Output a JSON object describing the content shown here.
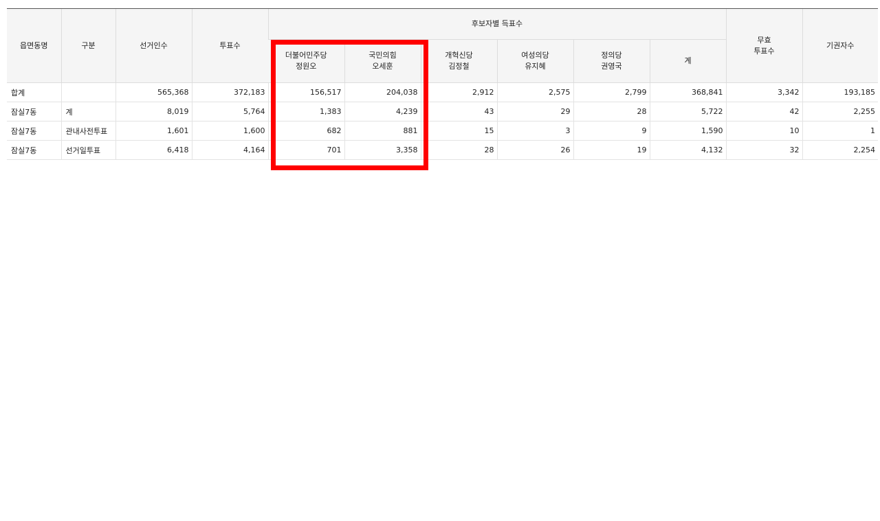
{
  "header": {
    "col_district": "읍면동명",
    "col_category": "구분",
    "col_electors": "선거인수",
    "col_voters": "투표수",
    "group_candidates": "후보자별 득표수",
    "col_invalid": "무효\n투표수",
    "col_abstain": "기권자수",
    "candidates": [
      {
        "party": "더불어민주당",
        "name": "정원오"
      },
      {
        "party": "국민의힘",
        "name": "오세훈"
      },
      {
        "party": "개혁신당",
        "name": "김정철"
      },
      {
        "party": "여성의당",
        "name": "유지혜"
      },
      {
        "party": "정의당",
        "name": "권영국"
      }
    ],
    "col_sum": "계"
  },
  "rows": [
    {
      "district": "합계",
      "category": "",
      "electors": "565,368",
      "voters": "372,183",
      "c1": "156,517",
      "c2": "204,038",
      "c3": "2,912",
      "c4": "2,575",
      "c5": "2,799",
      "sum": "368,841",
      "invalid": "3,342",
      "abstain": "193,185"
    },
    {
      "district": "잠실7동",
      "category": "계",
      "electors": "8,019",
      "voters": "5,764",
      "c1": "1,383",
      "c2": "4,239",
      "c3": "43",
      "c4": "29",
      "c5": "28",
      "sum": "5,722",
      "invalid": "42",
      "abstain": "2,255"
    },
    {
      "district": "잠실7동",
      "category": "관내사전투표",
      "electors": "1,601",
      "voters": "1,600",
      "c1": "682",
      "c2": "881",
      "c3": "15",
      "c4": "3",
      "c5": "9",
      "sum": "1,590",
      "invalid": "10",
      "abstain": "1"
    },
    {
      "district": "잠실7동",
      "category": "선거일투표",
      "electors": "6,418",
      "voters": "4,164",
      "c1": "701",
      "c2": "3,358",
      "c3": "28",
      "c4": "26",
      "c5": "19",
      "sum": "4,132",
      "invalid": "32",
      "abstain": "2,254"
    }
  ],
  "highlight_color": "#ff0000"
}
